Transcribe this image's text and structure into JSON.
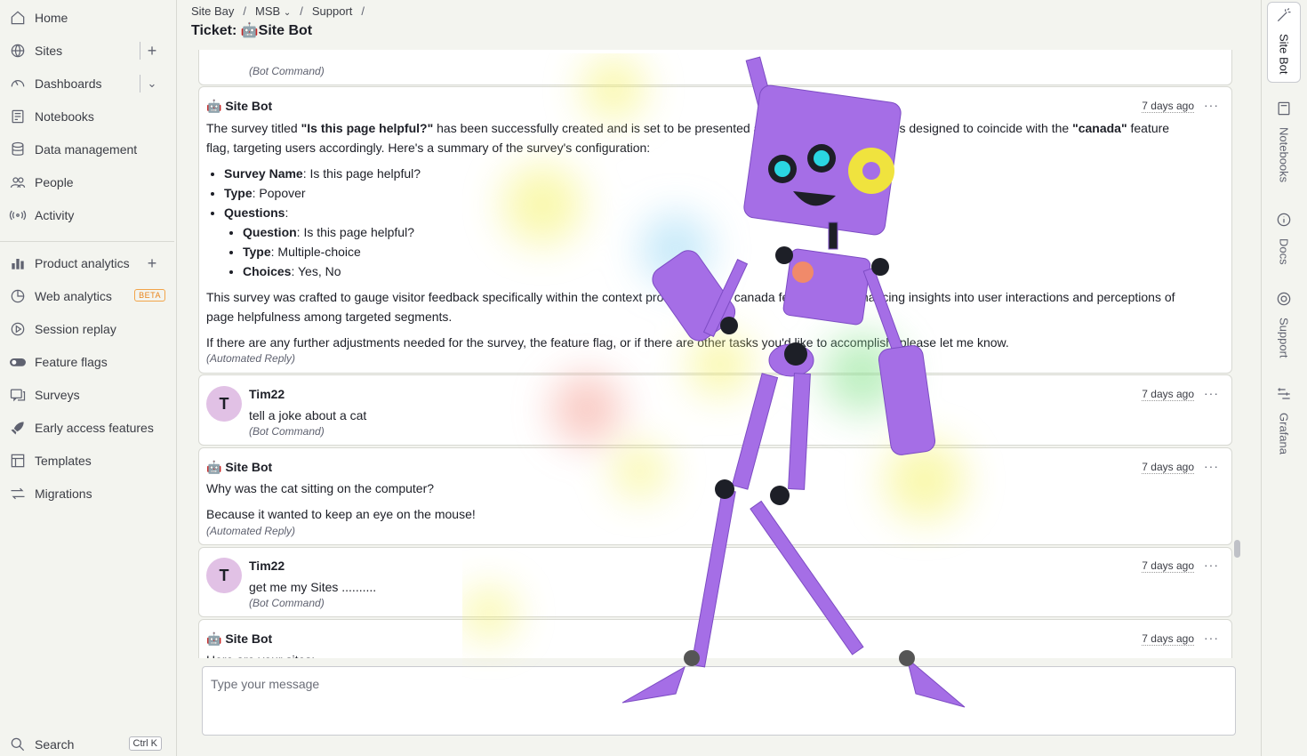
{
  "sidebar": {
    "items": [
      {
        "label": "Home"
      },
      {
        "label": "Sites"
      },
      {
        "label": "Dashboards"
      },
      {
        "label": "Notebooks"
      },
      {
        "label": "Data management"
      },
      {
        "label": "People"
      },
      {
        "label": "Activity"
      },
      {
        "label": "Product analytics"
      },
      {
        "label": "Web analytics",
        "badge": "BETA"
      },
      {
        "label": "Session replay"
      },
      {
        "label": "Feature flags"
      },
      {
        "label": "Surveys"
      },
      {
        "label": "Early access features"
      },
      {
        "label": "Templates"
      },
      {
        "label": "Migrations"
      }
    ],
    "search": {
      "label": "Search",
      "shortcut": "Ctrl K"
    }
  },
  "breadcrumb": [
    "Site Bay",
    "MSB",
    "Support"
  ],
  "page_title": "Ticket: 🤖Site Bot",
  "messages": {
    "m0": {
      "meta": "(Bot Command)"
    },
    "m1": {
      "name": "🤖 Site Bot",
      "time": "7 days ago",
      "intro_a": "The survey titled ",
      "intro_b": "\"Is this page helpful?\"",
      "intro_c": " has been successfully created and is set to be presented as a popover. The survey is designed to coincide with the ",
      "intro_d": "\"canada\"",
      "intro_e": " feature flag, targeting users accordingly. Here's a summary of the survey's configuration:",
      "bullets": {
        "b1k": "Survey Name",
        "b1v": ": Is this page helpful?",
        "b2k": "Type",
        "b2v": ": Popover",
        "b3k": "Questions",
        "b3v": ":",
        "q1k": "Question",
        "q1v": ": Is this page helpful?",
        "q2k": "Type",
        "q2v": ": Multiple-choice",
        "q3k": "Choices",
        "q3v": ": Yes, No"
      },
      "p2": "This survey was crafted to gauge visitor feedback specifically within the context provided by the canada feature flag, enhancing insights into user interactions and perceptions of page helpfulness among targeted segments.",
      "p3": "If there are any further adjustments needed for the survey, the feature flag, or if there are other tasks you'd like to accomplish, please let me know.",
      "meta": "(Automated Reply)"
    },
    "m2": {
      "avatar": "T",
      "name": "Tim22",
      "time": "7 days ago",
      "text": "tell a joke about a cat",
      "meta": "(Bot Command)"
    },
    "m3": {
      "name": "🤖 Site Bot",
      "time": "7 days ago",
      "l1": "Why was the cat sitting on the computer?",
      "l2": "Because it wanted to keep an eye on the mouse!",
      "meta": "(Automated Reply)"
    },
    "m4": {
      "avatar": "T",
      "name": "Tim22",
      "time": "7 days ago",
      "text": "get me my Sites ..........",
      "meta": "(Bot Command)"
    },
    "m5": {
      "name": "🤖 Site Bot",
      "time": "7 days ago",
      "text": "Here are your sites:"
    }
  },
  "composer": {
    "placeholder": "Type your message"
  },
  "rightbar": {
    "tabs": [
      "Site Bot",
      "Notebooks",
      "Docs",
      "Support",
      "Grafana"
    ]
  },
  "colors": {
    "avatar_bg": "#e1c1e5",
    "beta_badge": "#f2a449",
    "robot": "#a56ee6"
  }
}
